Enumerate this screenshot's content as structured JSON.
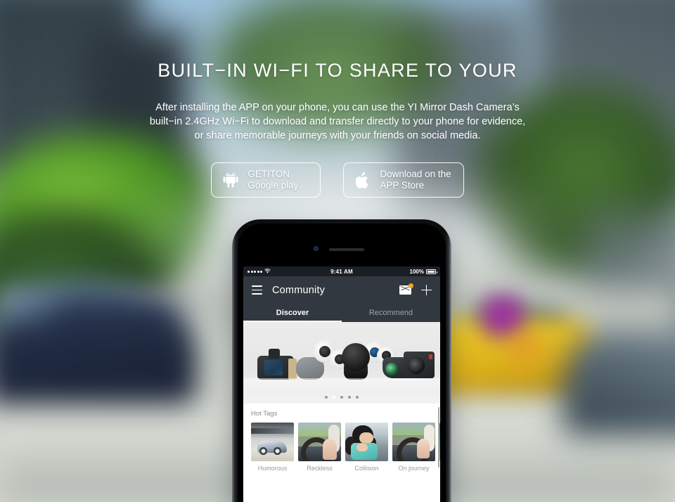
{
  "hero": {
    "headline": "BUILT−IN WI−FI TO SHARE TO YOUR",
    "paragraph_lines": [
      "After installing the APP on your phone, you can use the YI Mirror Dash Camera’s",
      "built−in 2.4GHz Wi−Fi to download and transfer directly to your phone for evidence,",
      "or share memorable journeys with your friends on social media."
    ]
  },
  "stores": [
    {
      "icon": "android-icon",
      "line1": "GETITON",
      "line2": "Google play"
    },
    {
      "icon": "apple-icon",
      "line1": "Download on the",
      "line2": "APP Store"
    }
  ],
  "phone": {
    "statusbar": {
      "time": "9:41 AM",
      "battery": "100%",
      "signal_dots": 5,
      "wifi": "wifi-icon"
    },
    "appbar": {
      "menu": "hamburger-icon",
      "title": "Community",
      "mail": "mail-icon",
      "mail_badge": true,
      "add": "plus-icon"
    },
    "tabs": [
      {
        "label": "Discover",
        "active": true
      },
      {
        "label": "Recommend",
        "active": false
      }
    ],
    "banner": {
      "dots_total": 5,
      "dot_active_index": 1
    },
    "hot_tags": {
      "title": "Hot Tags",
      "items": [
        {
          "label": "Humorous"
        },
        {
          "label": "Reckless"
        },
        {
          "label": "Collision"
        },
        {
          "label": "On journey"
        },
        {
          "label": ""
        }
      ]
    }
  },
  "colors": {
    "badge_orange": "#f5a623",
    "appbar_dark": "#32383f",
    "statusbar_dark": "#1b1f24",
    "text_white": "#ffffff",
    "tab_inactive": "#9aa2aa"
  }
}
